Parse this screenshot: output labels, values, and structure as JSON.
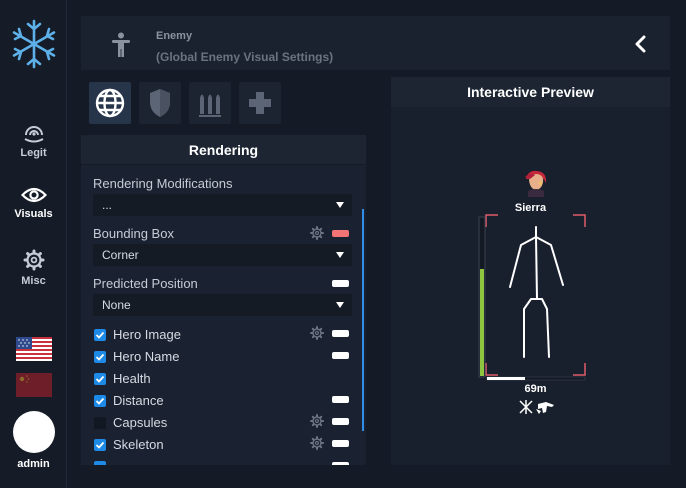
{
  "sidebar": {
    "items": [
      {
        "label": "Legit",
        "icon": "target-icon"
      },
      {
        "label": "Visuals",
        "icon": "eye-icon"
      },
      {
        "label": "Misc",
        "icon": "gear-icon"
      }
    ],
    "user": {
      "name": "admin"
    },
    "flags": [
      "us-flag-icon",
      "cn-flag-icon"
    ]
  },
  "header": {
    "title": "Enemy",
    "subtitle": "(Global Enemy Visual Settings)"
  },
  "tabs": [
    "globe-icon",
    "shield-icon",
    "ammo-icon",
    "plus-icon"
  ],
  "rendering": {
    "title": "Rendering",
    "modifications_label": "Rendering Modifications",
    "modifications_value": "...",
    "bbox_label": "Bounding Box",
    "bbox_value": "Corner",
    "predicted_label": "Predicted Position",
    "predicted_value": "None",
    "toggles": [
      {
        "label": "Hero Image",
        "checked": true
      },
      {
        "label": "Hero Name",
        "checked": true
      },
      {
        "label": "Health",
        "checked": true
      },
      {
        "label": "Distance",
        "checked": true
      },
      {
        "label": "Capsules",
        "checked": false
      },
      {
        "label": "Skeleton",
        "checked": true
      }
    ]
  },
  "preview": {
    "title": "Interactive Preview",
    "hero_name": "Sierra",
    "distance": "69m",
    "health_fraction": 0.68
  },
  "colors": {
    "accent": "#1d8ae8",
    "bbox_color": "#f27474",
    "health": "#8ec63f",
    "box_corner": "#e05a6a"
  }
}
